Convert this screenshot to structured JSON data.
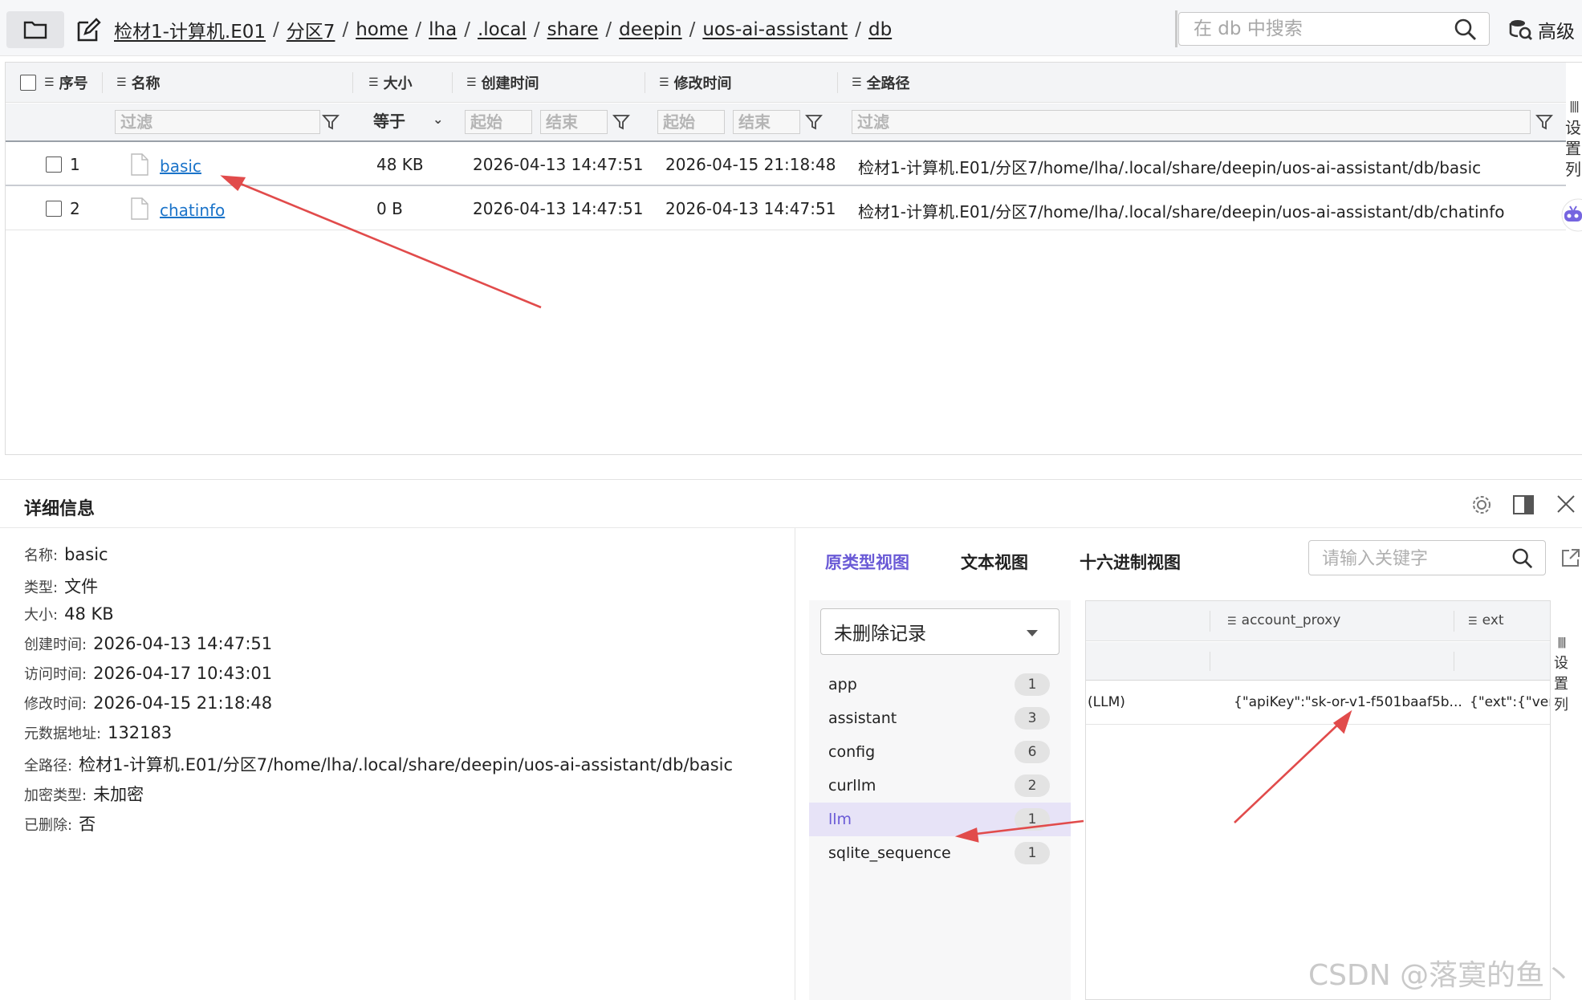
{
  "breadcrumb": [
    "检材1-计算机.E01",
    "分区7",
    "home",
    "lha",
    ".local",
    "share",
    "deepin",
    "uos-ai-assistant",
    "db"
  ],
  "search": {
    "placeholder": "在 db 中搜索"
  },
  "advanced_label": "高级",
  "table": {
    "headers": {
      "index": "序号",
      "name": "名称",
      "size": "大小",
      "created": "创建时间",
      "modified": "修改时间",
      "fullpath": "全路径"
    },
    "filters": {
      "name": "过滤",
      "size_op": "等于",
      "created_start": "起始",
      "created_end": "结束",
      "modified_start": "起始",
      "modified_end": "结束",
      "fullpath": "过滤"
    },
    "rows": [
      {
        "index": "1",
        "name": "basic",
        "size": "48 KB",
        "created": "2026-04-13 14:47:51",
        "modified": "2026-04-15 21:18:48",
        "fullpath": "检材1-计算机.E01/分区7/home/lha/.local/share/deepin/uos-ai-assistant/db/basic"
      },
      {
        "index": "2",
        "name": "chatinfo",
        "size": "0 B",
        "created": "2026-04-13 14:47:51",
        "modified": "2026-04-13 14:47:51",
        "fullpath": "检材1-计算机.E01/分区7/home/lha/.local/share/deepin/uos-ai-assistant/db/chatinfo"
      }
    ],
    "side_label": "设置列"
  },
  "detail": {
    "title": "详细信息",
    "props": [
      {
        "k": "名称:",
        "v": "basic"
      },
      {
        "k": "类型:",
        "v": "文件"
      },
      {
        "k": "大小:",
        "v": "48 KB"
      },
      {
        "k": "创建时间:",
        "v": "2026-04-13 14:47:51"
      },
      {
        "k": "访问时间:",
        "v": "2026-04-17 10:43:01"
      },
      {
        "k": "修改时间:",
        "v": "2026-04-15 21:18:48"
      },
      {
        "k": "元数据地址:",
        "v": "132183"
      },
      {
        "k": "全路径:",
        "v": "检材1-计算机.E01/分区7/home/lha/.local/share/deepin/uos-ai-assistant/db/basic"
      },
      {
        "k": "加密类型:",
        "v": "未加密"
      },
      {
        "k": "已删除:",
        "v": "否"
      }
    ],
    "tabs": [
      "原类型视图",
      "文本视图",
      "十六进制视图"
    ],
    "keyword_placeholder": "请输入关键字",
    "record_select": "未删除记录",
    "tables": [
      {
        "name": "app",
        "count": "1"
      },
      {
        "name": "assistant",
        "count": "3"
      },
      {
        "name": "config",
        "count": "6"
      },
      {
        "name": "curllm",
        "count": "2"
      },
      {
        "name": "llm",
        "count": "1"
      },
      {
        "name": "sqlite_sequence",
        "count": "1"
      }
    ],
    "grid": {
      "headers": [
        "account_proxy",
        "ext"
      ],
      "row": [
        "(LLM)",
        "{\"apiKey\":\"sk-or-v1-f501baaf5b...",
        "{\"ext\":{\"vend"
      ]
    },
    "grid_side_label": "设置列"
  },
  "watermark": "CSDN @落寞的鱼丶",
  "colors": {
    "accent": "#6a5ad6",
    "link": "#1a73c9",
    "annotation": "#e14b4b"
  }
}
